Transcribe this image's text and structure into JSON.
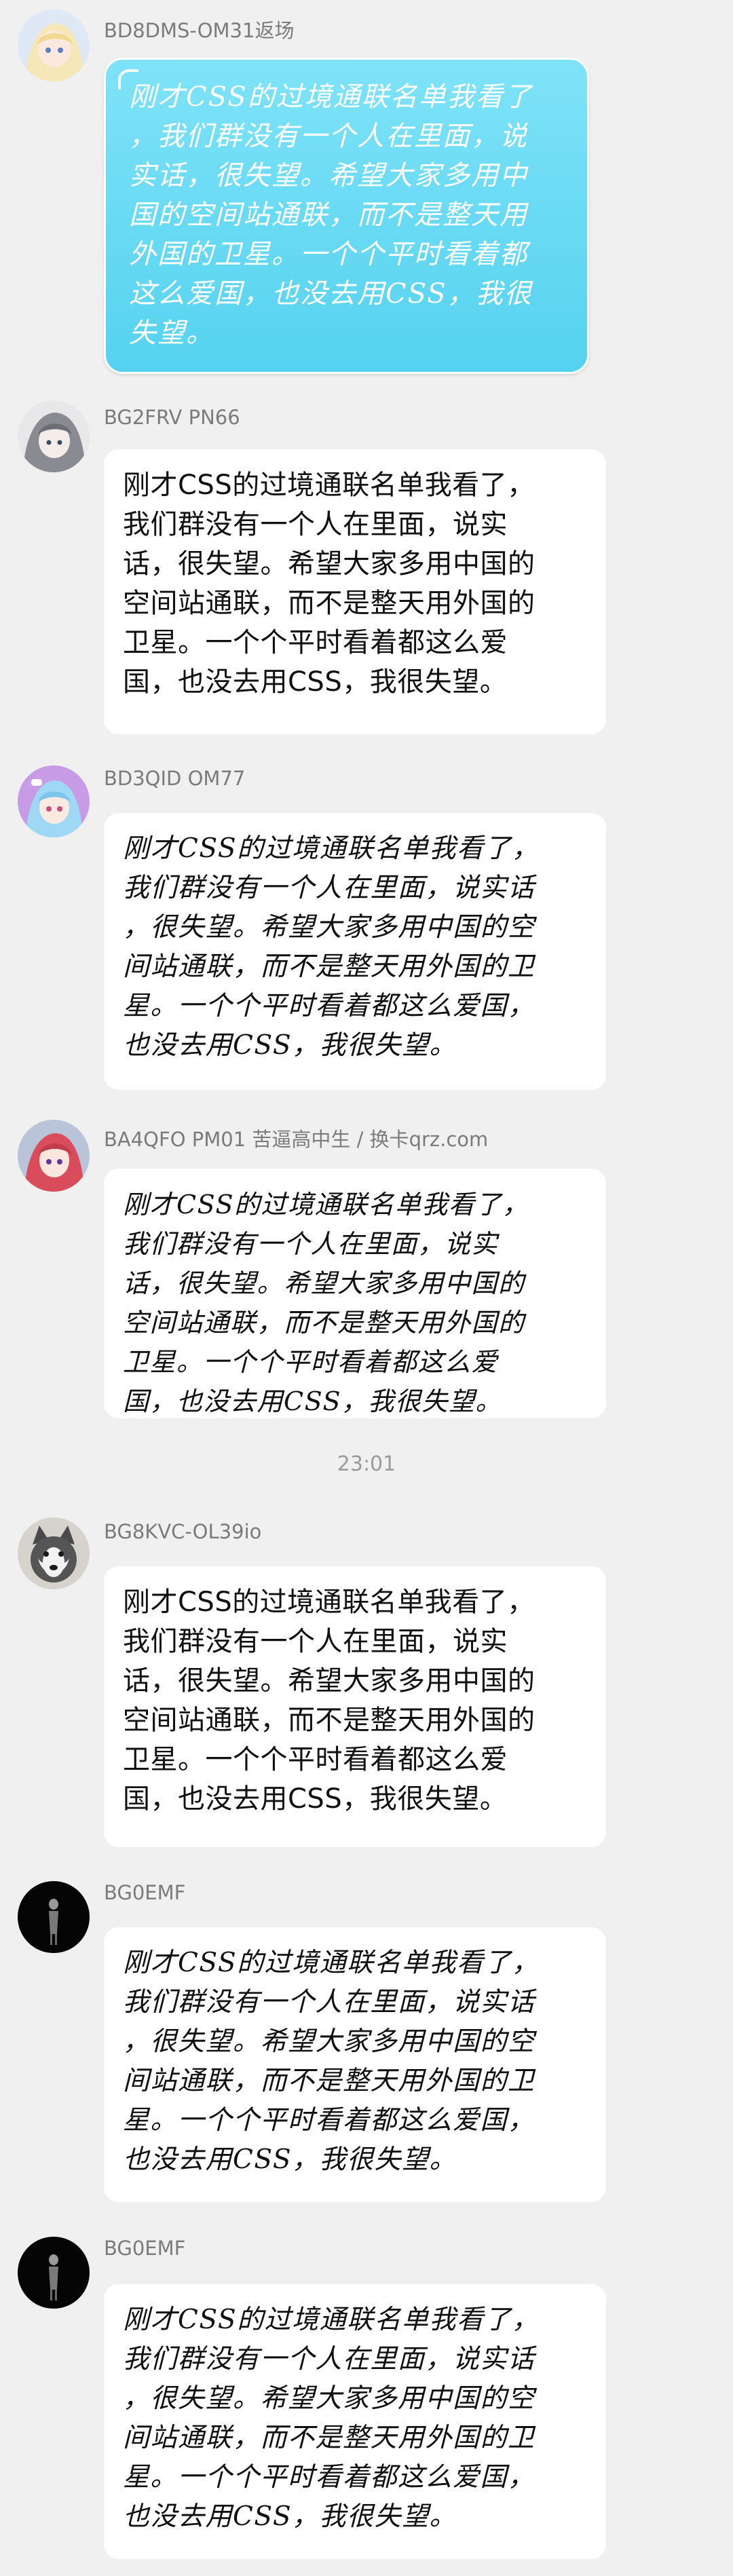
{
  "timestamp": "23:01",
  "messages": [
    {
      "sender": "BD8DMS-OM31返场",
      "text": "刚才CSS的过境通联名单我看了\n，我们群没有一个人在里面，说\n实话，很失望。希望大家多用中\n国的空间站通联，而不是整天用\n外国的卫星。一个个平时看着都\n这么爱国，也没去用CSS，我很\n失望。"
    },
    {
      "sender": "BG2FRV PN66",
      "text": "刚才CSS的过境通联名单我看了，\n我们群没有一个人在里面，说实\n话，很失望。希望大家多用中国的\n空间站通联，而不是整天用外国的\n卫星。一个个平时看着都这么爱\n国，也没去用CSS，我很失望。"
    },
    {
      "sender": "BD3QID OM77",
      "text": "刚才CSS的过境通联名单我看了，\n我们群没有一个人在里面，说实话\n，很失望。希望大家多用中国的空\n间站通联，而不是整天用外国的卫\n星。一个个平时看着都这么爱国，\n也没去用CSS，我很失望。"
    },
    {
      "sender": "BA4QFO PM01 苦逼高中生 / 换卡qrz.com",
      "text": "刚才CSS的过境通联名单我看了，\n我们群没有一个人在里面，说实\n话，很失望。希望大家多用中国的\n空间站通联，而不是整天用外国的\n卫星。一个个平时看着都这么爱\n国，也没去用CSS，我很失望。"
    },
    {
      "sender": "BG8KVC-OL39io",
      "text": "刚才CSS的过境通联名单我看了，\n我们群没有一个人在里面，说实\n话，很失望。希望大家多用中国的\n空间站通联，而不是整天用外国的\n卫星。一个个平时看着都这么爱\n国，也没去用CSS，我很失望。"
    },
    {
      "sender": "BG0EMF",
      "text": "刚才CSS的过境通联名单我看了，\n我们群没有一个人在里面，说实话\n，很失望。希望大家多用中国的空\n间站通联，而不是整天用外国的卫\n星。一个个平时看着都这么爱国，\n也没去用CSS，我很失望。"
    },
    {
      "sender": "BG0EMF",
      "text": "刚才CSS的过境通联名单我看了，\n我们群没有一个人在里面，说实话\n，很失望。希望大家多用中国的空\n间站通联，而不是整天用外国的卫\n星。一个个平时看着都这么爱国，\n也没去用CSS，我很失望。"
    }
  ]
}
